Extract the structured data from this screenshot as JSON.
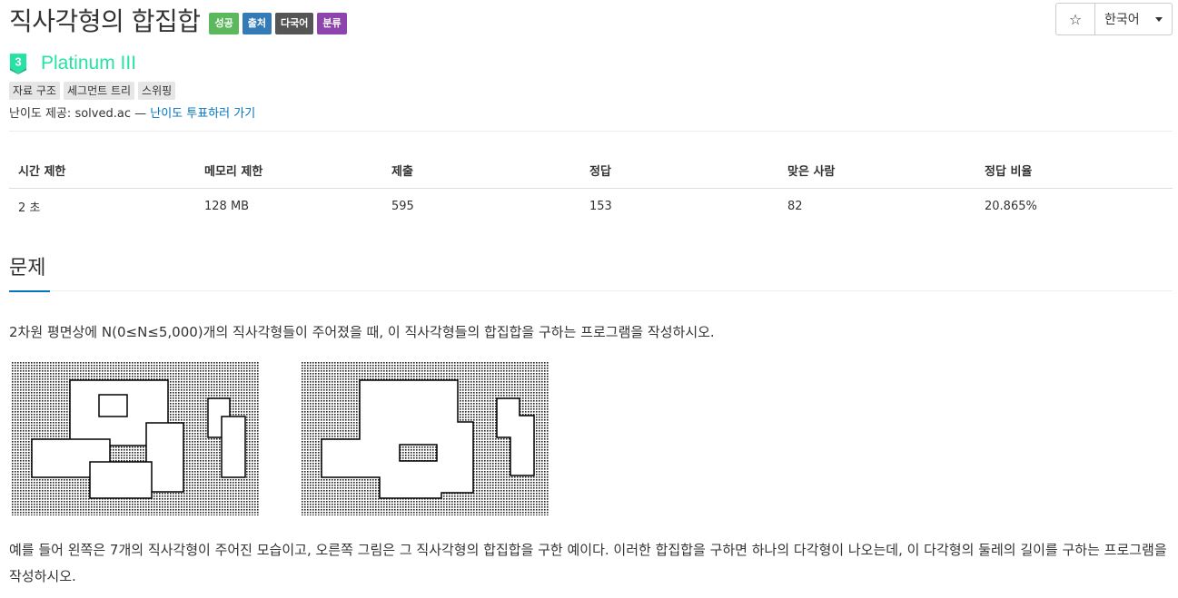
{
  "problem": {
    "title": "직사각형의 합집합",
    "badges": [
      {
        "label": "성공",
        "color": "#5cb85c"
      },
      {
        "label": "출처",
        "color": "#337ab7"
      },
      {
        "label": "다국어",
        "color": "#555555"
      },
      {
        "label": "분류",
        "color": "#8e44ad"
      }
    ]
  },
  "toolbar": {
    "star_icon": "star-icon",
    "star_glyph": "☆",
    "language_label": "한국어"
  },
  "tier": {
    "number": "3",
    "name": "Platinum III",
    "color": "#27e2a4"
  },
  "tags": [
    "자료 구조",
    "세그먼트 트리",
    "스위핑"
  ],
  "provider": {
    "prefix": "난이도 제공: solved.ac — ",
    "link": "난이도 투표하러 가기"
  },
  "info_table": {
    "headers": [
      "시간 제한",
      "메모리 제한",
      "제출",
      "정답",
      "맞은 사람",
      "정답 비율"
    ],
    "values": [
      "2 초",
      "128 MB",
      "595",
      "153",
      "82",
      "20.865%"
    ]
  },
  "section": {
    "heading": "문제",
    "paragraph1": "2차원 평면상에 N(0≤N≤5,000)개의 직사각형들이 주어졌을 때, 이 직사각형들의 합집합을 구하는 프로그램을 작성하시오.",
    "paragraph2": "예를 들어 왼쪽은 7개의 직사각형이 주어진 모습이고, 오른쪽 그림은 그 직사각형의 합집합을 구한 예이다. 이러한 합집합을 구하면 하나의 다각형이 나오는데, 이 다각형의 둘레의 길이를 구하는 프로그램을 작성하시오."
  },
  "colors": {
    "accent": "#0076c0",
    "platinum": "#27e2a4"
  }
}
